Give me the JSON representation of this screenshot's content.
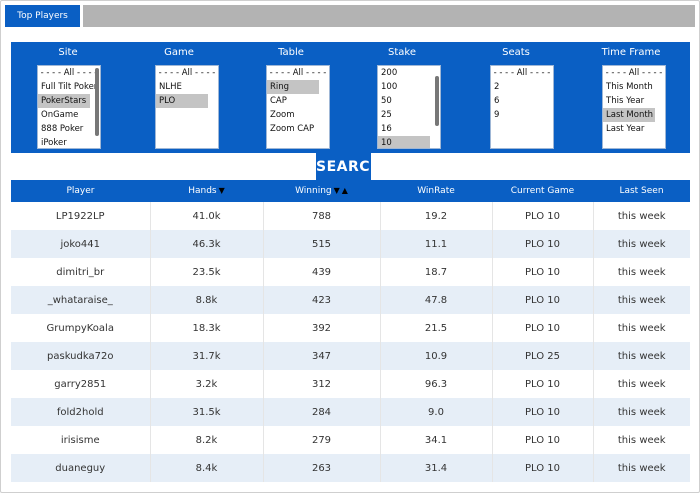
{
  "tab": {
    "label": "Top Players"
  },
  "filters": {
    "site": {
      "label": "Site",
      "options": [
        "- - - - All - - - -",
        "Full Tilt Poker",
        "PokerStars",
        "OnGame",
        "888 Poker",
        "iPoker"
      ],
      "selected": 2
    },
    "game": {
      "label": "Game",
      "options": [
        "- - - - All - - - -",
        "NLHE",
        "PLO"
      ],
      "selected": 2
    },
    "table": {
      "label": "Table",
      "options": [
        "- - - - All - - - -",
        "Ring",
        "CAP",
        "Zoom",
        "Zoom CAP"
      ],
      "selected": 1
    },
    "stake": {
      "label": "Stake",
      "options": [
        "200",
        "100",
        "50",
        "25",
        "16",
        "10"
      ],
      "selected": 5
    },
    "seats": {
      "label": "Seats",
      "options": [
        "- - - - All - - - -",
        "2",
        "6",
        "9"
      ],
      "selected": -1
    },
    "timeframe": {
      "label": "Time Frame",
      "options": [
        "- - - - All - - - -",
        "This Month",
        "This Year",
        "Last Month",
        "Last Year"
      ],
      "selected": 3
    }
  },
  "search": {
    "label": "SEARCH"
  },
  "table": {
    "headers": [
      "Player",
      "Hands",
      "Winning",
      "WinRate",
      "Current Game",
      "Last Seen"
    ],
    "rows": [
      [
        "LP1922LP",
        "41.0k",
        "788",
        "19.2",
        "PLO 10",
        "this week"
      ],
      [
        "joko441",
        "46.3k",
        "515",
        "11.1",
        "PLO 10",
        "this week"
      ],
      [
        "dimitri_br",
        "23.5k",
        "439",
        "18.7",
        "PLO 10",
        "this week"
      ],
      [
        "_whataraise_",
        "8.8k",
        "423",
        "47.8",
        "PLO 10",
        "this week"
      ],
      [
        "GrumpyKoala",
        "18.3k",
        "392",
        "21.5",
        "PLO 10",
        "this week"
      ],
      [
        "paskudka72o",
        "31.7k",
        "347",
        "10.9",
        "PLO 25",
        "this week"
      ],
      [
        "garry2851",
        "3.2k",
        "312",
        "96.3",
        "PLO 10",
        "this week"
      ],
      [
        "fold2hold",
        "31.5k",
        "284",
        "9.0",
        "PLO 10",
        "this week"
      ],
      [
        "irisisme",
        "8.2k",
        "279",
        "34.1",
        "PLO 10",
        "this week"
      ],
      [
        "duaneguy",
        "8.4k",
        "263",
        "31.4",
        "PLO 10",
        "this week"
      ]
    ]
  },
  "sort_icons": {
    "down": "▼",
    "up": "▲"
  }
}
